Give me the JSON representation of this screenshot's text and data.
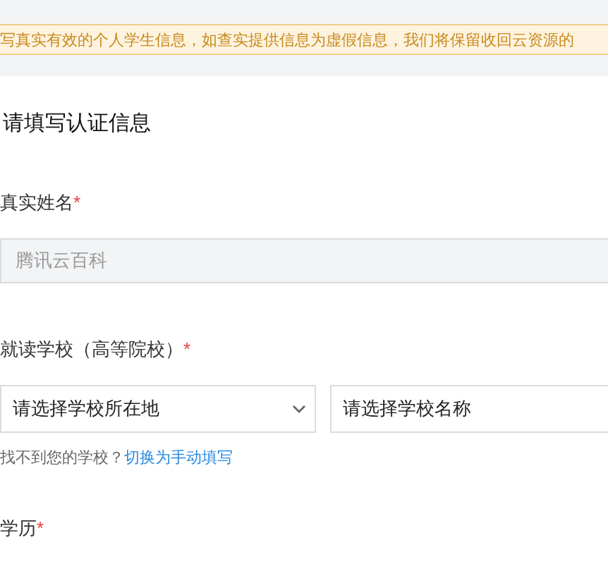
{
  "notice": {
    "text": "写真实有效的个人学生信息，如查实提供信息为虚假信息，我们将保留收回云资源的"
  },
  "form": {
    "title": "请填写认证信息",
    "fields": [
      {
        "kind": "text",
        "label": "真实姓名",
        "required": "*",
        "value": "腾讯云百科",
        "disabled": true
      },
      {
        "kind": "select-pair",
        "label": "就读学校（高等院校）",
        "required": "*",
        "selects": [
          {
            "placeholder": "请选择学校所在地",
            "kind": "dropdown"
          },
          {
            "placeholder": "请选择学校名称",
            "kind": "search"
          }
        ],
        "hint": "找不到您的学校？",
        "link": "切换为手动填写"
      },
      {
        "kind": "heading",
        "label": "学历",
        "required": "*"
      }
    ]
  }
}
